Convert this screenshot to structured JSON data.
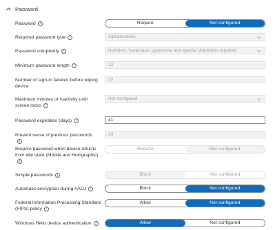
{
  "section": {
    "title": "Password"
  },
  "rows": {
    "password": {
      "label": "Password",
      "opt1": "Require",
      "opt2": "Not configured"
    },
    "type": {
      "label": "Required password type",
      "value": "Alphanumeric"
    },
    "complexity": {
      "label": "Password complexity",
      "value": "Numbers, lowercase, uppercase and special characters required"
    },
    "minlen": {
      "label": "Minimum password length",
      "value": "12"
    },
    "failures": {
      "label": "Number of sign-in failures before wiping device",
      "value": "10"
    },
    "inactivity": {
      "label": "Maximum minutes of inactivity until screen locks",
      "value": "Not configured"
    },
    "expiration": {
      "label": "Password expiration (days)",
      "value": "41"
    },
    "reuse": {
      "label": "Prevent reuse of previous passwords",
      "value": "24"
    },
    "idle": {
      "label": "Require password when device returns from idle state (Mobile and Holographic)",
      "opt1": "Require",
      "opt2": "Not configured"
    },
    "simple": {
      "label": "Simple passwords",
      "opt1": "Block",
      "opt2": "Not configured"
    },
    "encryption": {
      "label": "Automatic encryption during AADJ",
      "opt1": "Block",
      "opt2": "Not configured"
    },
    "fips": {
      "label": "Federal Information Processing Standard (FIPS) policy",
      "opt1": "Allow",
      "opt2": "Not configured"
    },
    "hello": {
      "label": "Windows Hello device authentication",
      "opt1": "Allow",
      "opt2": "Not configured"
    }
  },
  "icons": {
    "info": "info-icon",
    "chevron-up": "chevron-up-icon",
    "chevron-down": "chevron-down-icon"
  },
  "colors": {
    "accent": "#0f6cbd",
    "disabled_bg": "#f3f2f1",
    "text": "#323130"
  }
}
